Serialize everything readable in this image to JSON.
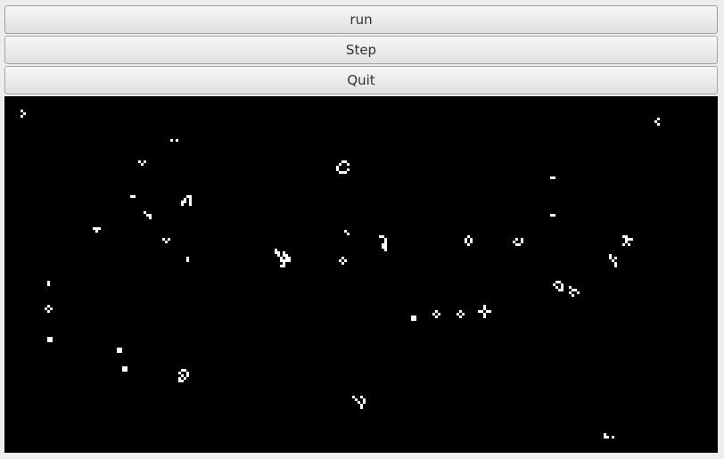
{
  "toolbar": {
    "run_label": "run",
    "step_label": "Step",
    "quit_label": "Quit"
  },
  "board": {
    "background": "#000000",
    "cell_color": "#ffffff"
  }
}
